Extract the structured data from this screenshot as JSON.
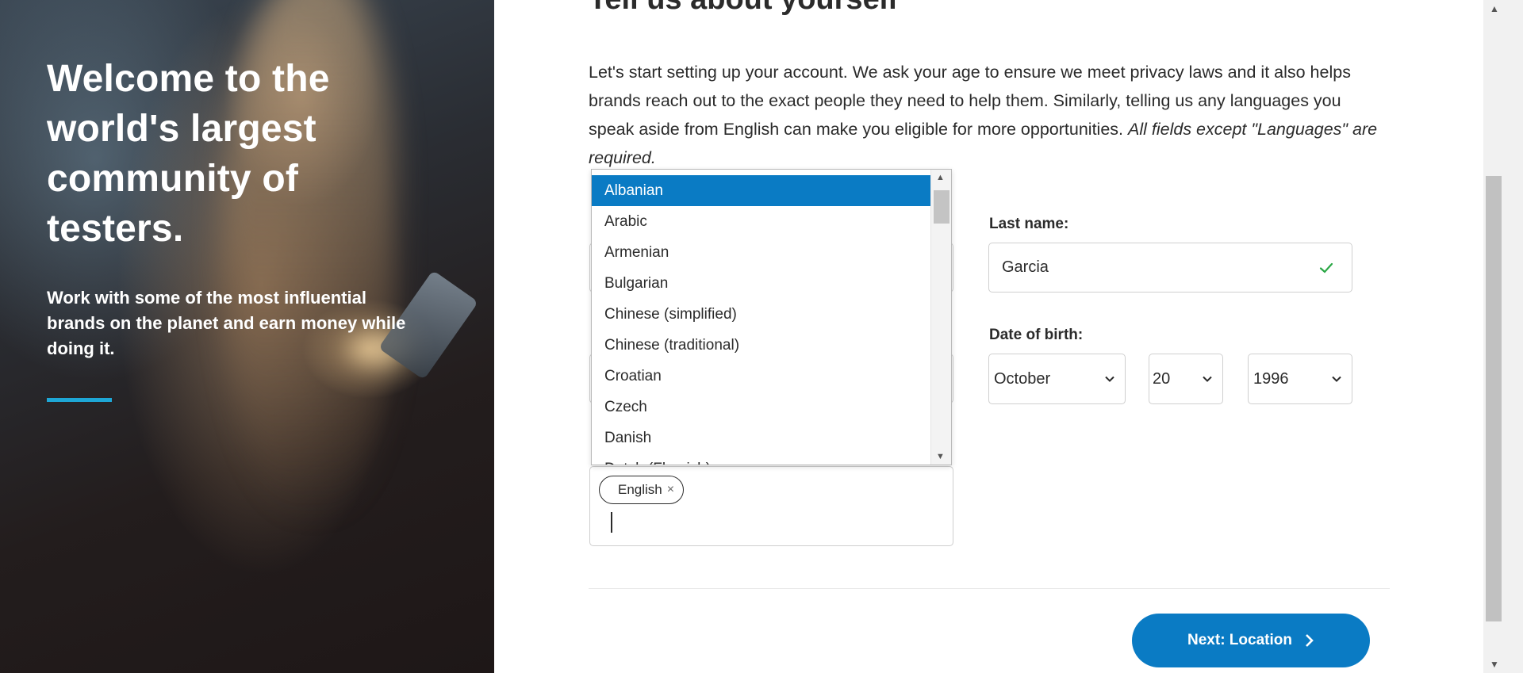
{
  "hero": {
    "title": "Welcome to the world's largest community of testers.",
    "subtitle": "Work with some of the most influential brands on the planet and earn money while doing it.",
    "accent_color": "#1ea7d6"
  },
  "form": {
    "heading": "Tell us about yourself",
    "intro": "Let's start setting up your account. We ask your age to ensure we meet privacy laws and it also helps brands reach out to the exact people they need to help them. Similarly, telling us any languages you speak aside from English can make you eligible for more opportunities.",
    "intro_note": "All fields except \"Languages\" are required.",
    "last_name": {
      "label": "Last name:",
      "value": "Garcia"
    },
    "dob": {
      "label": "Date of birth:",
      "month": "October",
      "day": "20",
      "year": "1996"
    },
    "languages": {
      "chip": "English",
      "chip_remove": "×"
    },
    "next_button": "Next: Location"
  },
  "language_dropdown": {
    "options": [
      "Albanian",
      "Arabic",
      "Armenian",
      "Bulgarian",
      "Chinese (simplified)",
      "Chinese (traditional)",
      "Croatian",
      "Czech",
      "Danish",
      "Dutch (Flemish)"
    ],
    "selected": "Albanian"
  },
  "colors": {
    "primary": "#0a7bc4",
    "valid_check": "#2aa745"
  },
  "icons": [
    "check-icon",
    "chevron-down-icon",
    "chevron-right-icon",
    "close-icon"
  ]
}
